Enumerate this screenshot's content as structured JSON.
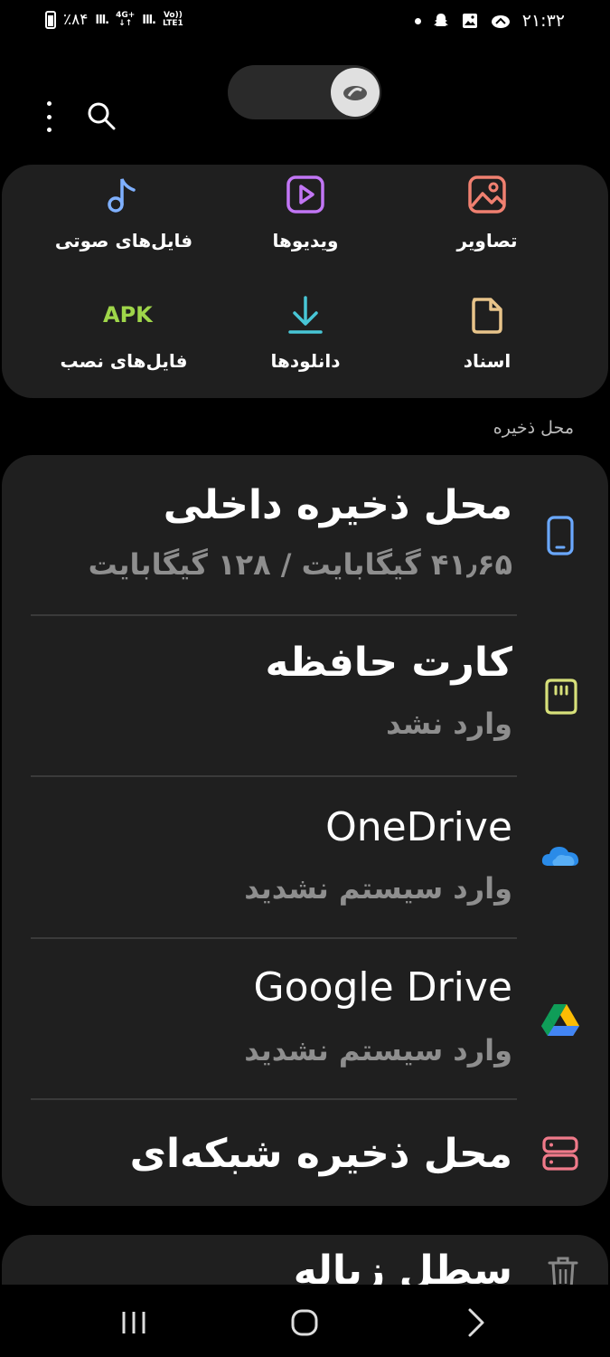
{
  "status_bar": {
    "battery": "٪۸۴",
    "network_type": "4G+",
    "volte": "Vo))",
    "lte": "LTE1",
    "time": "۲۱:۳۲"
  },
  "header": {
    "toggle_icon": "cloud-icon",
    "menu_icon": "more-vert-icon",
    "search_icon": "search-icon"
  },
  "categories": [
    {
      "label": "تصاویر",
      "icon": "image-icon",
      "color": "#f08070"
    },
    {
      "label": "ویدیوها",
      "icon": "video-icon",
      "color": "#c276f5"
    },
    {
      "label": "فایل‌های صوتی",
      "icon": "music-note-icon",
      "color": "#7fb0ff"
    },
    {
      "label": "اسناد",
      "icon": "document-icon",
      "color": "#e8c48a"
    },
    {
      "label": "دانلودها",
      "icon": "download-icon",
      "color": "#48c6d6"
    },
    {
      "label": "فایل‌های نصب",
      "icon": "apk-icon",
      "color": "#9fd64a",
      "icon_text": "APK"
    }
  ],
  "storage_section": {
    "label": "محل ذخیره",
    "items": [
      {
        "title": "محل ذخیره داخلی",
        "subtitle": "۴۱٫۶۵ گیگابایت / ۱۲۸ گیگابایت",
        "icon": "phone-icon",
        "color": "#6aa8ff"
      },
      {
        "title": "کارت حافظه",
        "subtitle": "وارد نشد",
        "icon": "sd-card-icon",
        "color": "#d7e07a"
      },
      {
        "title": "OneDrive",
        "subtitle": "وارد سیستم نشدید",
        "icon": "onedrive-icon",
        "color": "#2a8be8"
      },
      {
        "title": "Google Drive",
        "subtitle": "وارد سیستم نشدید",
        "icon": "google-drive-icon",
        "color": "#34a853"
      },
      {
        "title": "محل ذخیره شبکه‌ای",
        "icon": "network-storage-icon",
        "color": "#f07a8a"
      }
    ]
  },
  "trash": {
    "title": "سطل زباله",
    "icon": "trash-icon"
  },
  "nav_bar": {
    "recents": "recents-icon",
    "home": "home-icon",
    "back": "back-icon"
  }
}
